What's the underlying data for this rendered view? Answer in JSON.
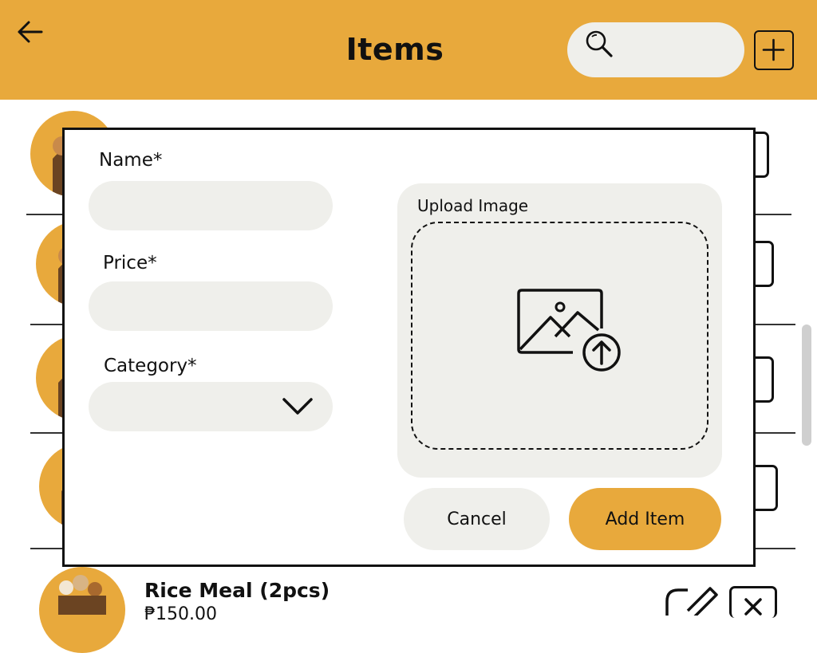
{
  "header": {
    "title": "Items",
    "search_placeholder": "",
    "back_icon": "arrow-left-icon",
    "search_icon": "search-icon",
    "add_icon": "plus-square-icon"
  },
  "list": {
    "items": [
      {
        "name": "Rice Meal (2pcs)",
        "price": "₱150.00"
      }
    ]
  },
  "modal": {
    "name_label": "Name*",
    "name_value": "",
    "price_label": "Price*",
    "price_value": "",
    "category_label": "Category*",
    "category_value": "",
    "upload_label": "Upload Image",
    "upload_icon": "image-upload-icon",
    "cancel_label": "Cancel",
    "add_label": "Add Item"
  },
  "colors": {
    "accent": "#e8a93c",
    "field_bg": "#efefeb",
    "text": "#111111"
  }
}
